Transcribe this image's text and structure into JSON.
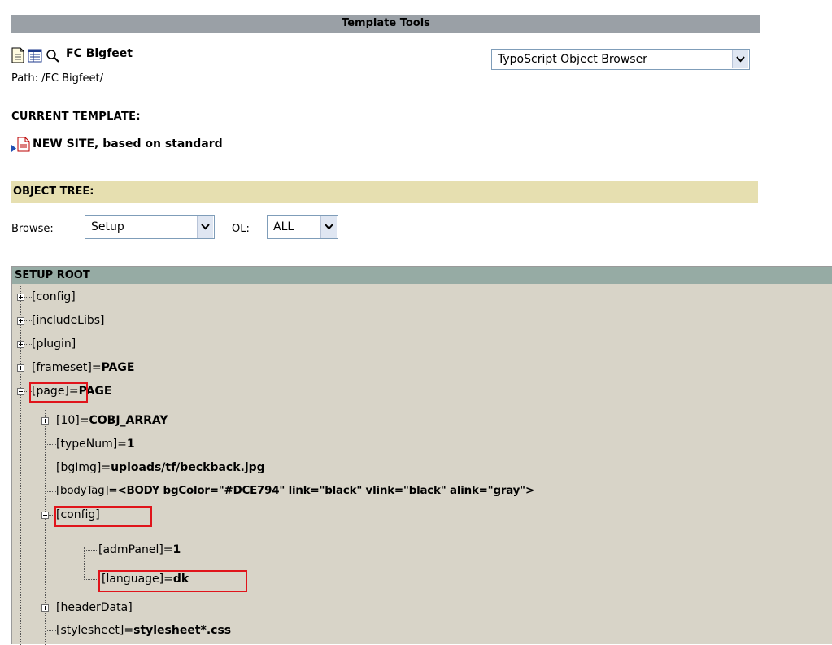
{
  "header": {
    "title": "Template Tools"
  },
  "page": {
    "name": "FC Bigfeet",
    "path": "Path: /FC Bigfeet/"
  },
  "function_select": {
    "value": "TypoScript Object Browser"
  },
  "current_template": {
    "label": "CURRENT TEMPLATE:",
    "name": "NEW SITE, based on standard"
  },
  "object_tree": {
    "label": "OBJECT TREE:",
    "browse_label": "Browse:",
    "browse_value": "Setup",
    "ol_label": "OL:",
    "ol_value": "ALL"
  },
  "tree": {
    "header": "SETUP ROOT",
    "rows": [
      {
        "key": "[config]",
        "value": ""
      },
      {
        "key": "[includeLibs]",
        "value": ""
      },
      {
        "key": "[plugin]",
        "value": ""
      },
      {
        "key": "[frameset]=",
        "value": "PAGE"
      },
      {
        "key": "[page]=",
        "value": "PAGE"
      },
      {
        "key": "[10]=",
        "value": "COBJ_ARRAY"
      },
      {
        "key": "[typeNum]=",
        "value": "1"
      },
      {
        "key": "[bgImg]=",
        "value": "uploads/tf/beckback.jpg"
      },
      {
        "key": "[bodyTag]=",
        "value": "<BODY bgColor=\"#DCE794\" link=\"black\" vlink=\"black\" alink=\"gray\">"
      },
      {
        "key": "[config]",
        "value": ""
      },
      {
        "key": "[admPanel]=",
        "value": "1"
      },
      {
        "key": "[language]=",
        "value": "dk"
      },
      {
        "key": "[headerData]",
        "value": ""
      },
      {
        "key": "[stylesheet]=",
        "value": "stylesheet*.css"
      }
    ]
  },
  "colors": {
    "highlight": "#e0141b",
    "tree_bg": "#d8d4c8",
    "tree_header": "#96aba4",
    "section_bar": "#e6dfb0",
    "title_bar": "#9aa0a6"
  }
}
